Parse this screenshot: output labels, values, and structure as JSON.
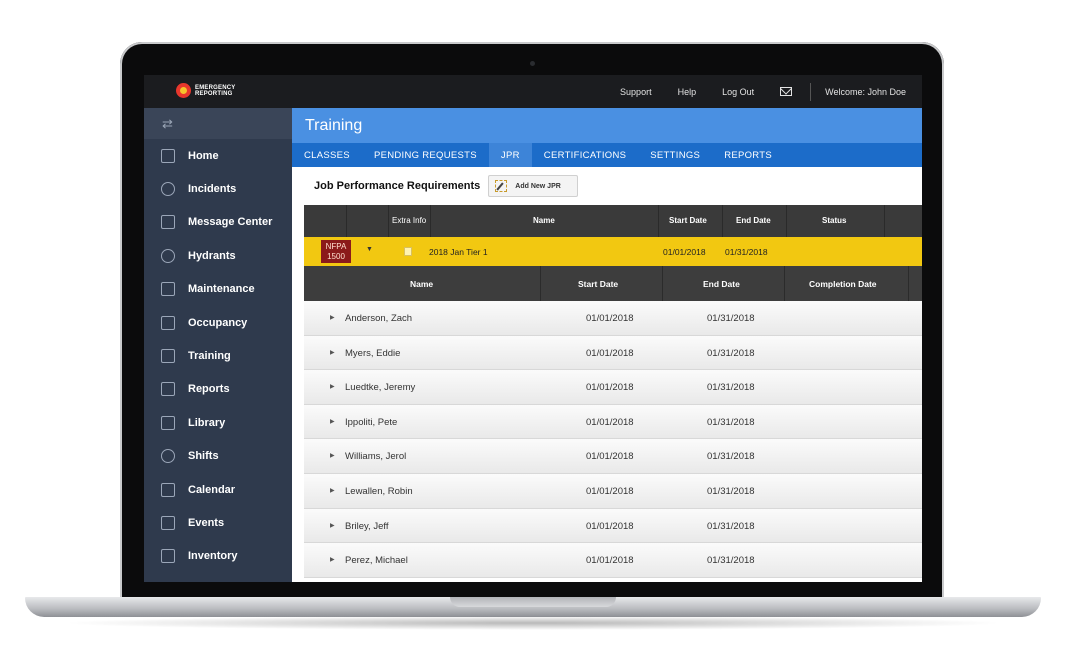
{
  "topbar": {
    "logo_line1": "EMERGENCY",
    "logo_line2": "REPORTING",
    "support": "Support",
    "help": "Help",
    "logout": "Log Out",
    "welcome": "Welcome: John Doe"
  },
  "sidebar": {
    "swap_glyph": "⇄",
    "items": [
      {
        "label": "Home",
        "icon": "home-icon"
      },
      {
        "label": "Incidents",
        "icon": "alarm-icon"
      },
      {
        "label": "Message Center",
        "icon": "mail-icon"
      },
      {
        "label": "Hydrants",
        "icon": "hydrant-icon"
      },
      {
        "label": "Maintenance",
        "icon": "wrench-icon"
      },
      {
        "label": "Occupancy",
        "icon": "building-icon"
      },
      {
        "label": "Training",
        "icon": "training-icon"
      },
      {
        "label": "Reports",
        "icon": "report-icon"
      },
      {
        "label": "Library",
        "icon": "library-icon"
      },
      {
        "label": "Shifts",
        "icon": "clock-icon"
      },
      {
        "label": "Calendar",
        "icon": "calendar-icon"
      },
      {
        "label": "Events",
        "icon": "star-icon"
      },
      {
        "label": "Inventory",
        "icon": "inventory-icon"
      }
    ]
  },
  "main": {
    "title": "Training",
    "tabs": [
      "CLASSES",
      "PENDING REQUESTS",
      "JPR",
      "CERTIFICATIONS",
      "SETTINGS",
      "REPORTS"
    ],
    "active_tab": "JPR",
    "section_title": "Job Performance Requirements",
    "add_button": "Add New JPR",
    "table_headers": {
      "extra_info": "Extra Info",
      "name": "Name",
      "start_date": "Start Date",
      "end_date": "End Date",
      "status": "Status"
    },
    "jpr": {
      "badge_line1": "NFPA",
      "badge_line2": "1500",
      "name": "2018 Jan Tier 1",
      "start": "01/01/2018",
      "end": "01/31/2018",
      "caret": "▼"
    },
    "sub_headers": {
      "name": "Name",
      "start_date": "Start Date",
      "end_date": "End Date",
      "completion_date": "Completion Date"
    },
    "rows": [
      {
        "name": "Anderson, Zach",
        "start": "01/01/2018",
        "end": "01/31/2018"
      },
      {
        "name": "Myers, Eddie",
        "start": "01/01/2018",
        "end": "01/31/2018"
      },
      {
        "name": "Luedtke, Jeremy",
        "start": "01/01/2018",
        "end": "01/31/2018"
      },
      {
        "name": "Ippoliti, Pete",
        "start": "01/01/2018",
        "end": "01/31/2018"
      },
      {
        "name": "Williams, Jerol",
        "start": "01/01/2018",
        "end": "01/31/2018"
      },
      {
        "name": "Lewallen, Robin",
        "start": "01/01/2018",
        "end": "01/31/2018"
      },
      {
        "name": "Briley, Jeff",
        "start": "01/01/2018",
        "end": "01/31/2018"
      },
      {
        "name": "Perez, Michael",
        "start": "01/01/2018",
        "end": "01/31/2018"
      }
    ],
    "row_arrow": "▶"
  },
  "colors": {
    "title_bar": "#4a90e2",
    "tab_bar": "#1c6cc9",
    "sidebar": "#2f3a4d",
    "highlight_row": "#f2c811",
    "badge": "#8b1a1a"
  }
}
